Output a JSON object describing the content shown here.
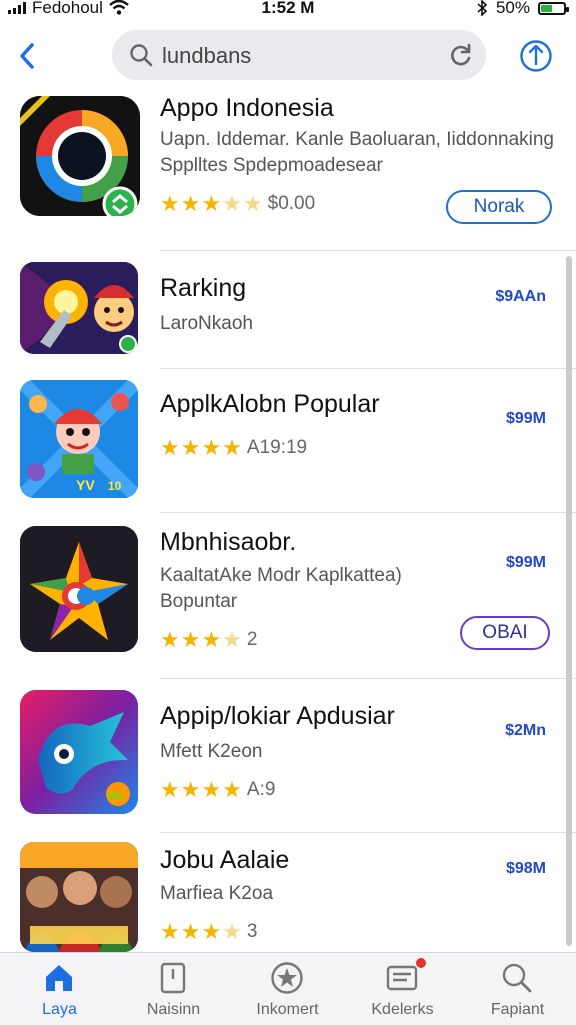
{
  "status_bar": {
    "carrier": "Fedohoul",
    "time": "1:52 M",
    "battery": "50%",
    "battery_level": 0.5
  },
  "search": {
    "value": "lundbans"
  },
  "apps": [
    {
      "title": "Appo Indonesia",
      "subtitle": [
        "Uapn. Iddemar. Kanle Baoluaran, Iiddonnaking",
        "Spplltes Spdepmoadesear"
      ],
      "stars": 3.5,
      "rating_text": "$0.00",
      "button": "Norak",
      "price": ""
    },
    {
      "title": "Rarking",
      "subtitle": [
        "LaroNkaoh"
      ],
      "stars": 0,
      "rating_text": "",
      "button": "",
      "price": "$9AAn"
    },
    {
      "title": "ApplkAlobn Popular",
      "subtitle": [],
      "stars": 4,
      "rating_text": "A19:19",
      "button": "",
      "price": "$99M"
    },
    {
      "title": "Mbnhisaobr.",
      "subtitle": [
        "KaaltatAke Modr Kaplkattea)",
        "Bopuntar"
      ],
      "stars": 3.5,
      "rating_text": "2",
      "button": "OBAI",
      "price": "$99M"
    },
    {
      "title": "Appip/lokiar Apdusiar",
      "subtitle": [
        "Mfett K2eon"
      ],
      "stars": 4,
      "rating_text": "A:9",
      "button": "",
      "price": "$2Mn"
    },
    {
      "title": "Jobu Aalaie",
      "subtitle": [
        "Marfiea K2oa"
      ],
      "stars": 3.5,
      "rating_text": "3",
      "button": "",
      "price": "$98M"
    }
  ],
  "tabs": [
    {
      "label": "Laya",
      "icon": "app-store-icon",
      "active": true
    },
    {
      "label": "Naisinn",
      "icon": "bookmark-icon",
      "active": false
    },
    {
      "label": "Inkomert",
      "icon": "star-icon",
      "active": false
    },
    {
      "label": "Kdelerks",
      "icon": "inbox-icon",
      "active": false
    },
    {
      "label": "Fapiant",
      "icon": "search-icon",
      "active": false
    }
  ],
  "colors": {
    "accent": "#1d6fe0",
    "price": "#2248c8",
    "star": "#f6b400"
  }
}
